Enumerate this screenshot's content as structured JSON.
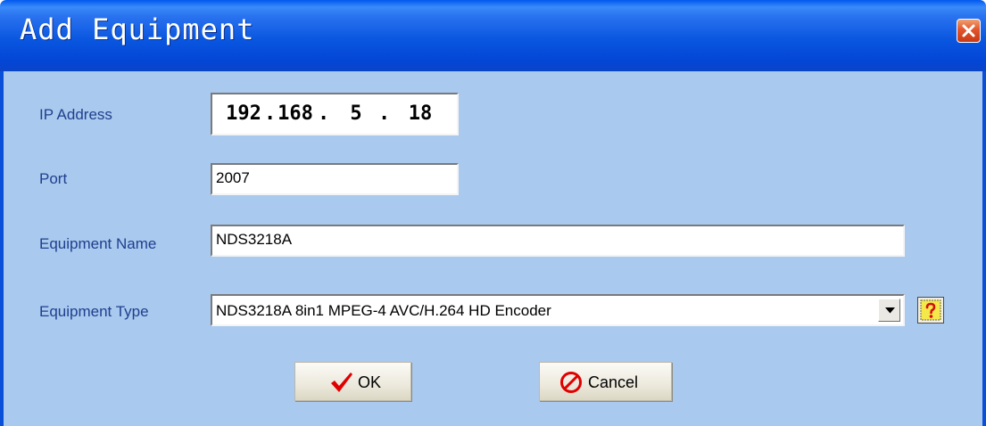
{
  "window": {
    "title": "Add Equipment",
    "close_icon": "close-icon"
  },
  "form": {
    "ip": {
      "label": "IP Address",
      "octets": [
        "192",
        "168",
        "5",
        "18"
      ],
      "separator": "."
    },
    "port": {
      "label": "Port",
      "value": "2007"
    },
    "name": {
      "label": "Equipment Name",
      "value": "NDS3218A"
    },
    "type": {
      "label": "Equipment Type",
      "value": "NDS3218A 8in1 MPEG-4 AVC/H.264 HD Encoder",
      "help_icon": "help-question-icon"
    }
  },
  "buttons": {
    "ok_label": "OK",
    "ok_icon": "checkmark-icon",
    "cancel_label": "Cancel",
    "cancel_icon": "prohibited-icon"
  },
  "colors": {
    "titlebar": "#0a57e0",
    "client_background": "#a9c9ee",
    "label_text": "#1f3f8f",
    "close_button": "#e2542c",
    "ok_check": "#e00000",
    "cancel_icon": "#e00000"
  }
}
